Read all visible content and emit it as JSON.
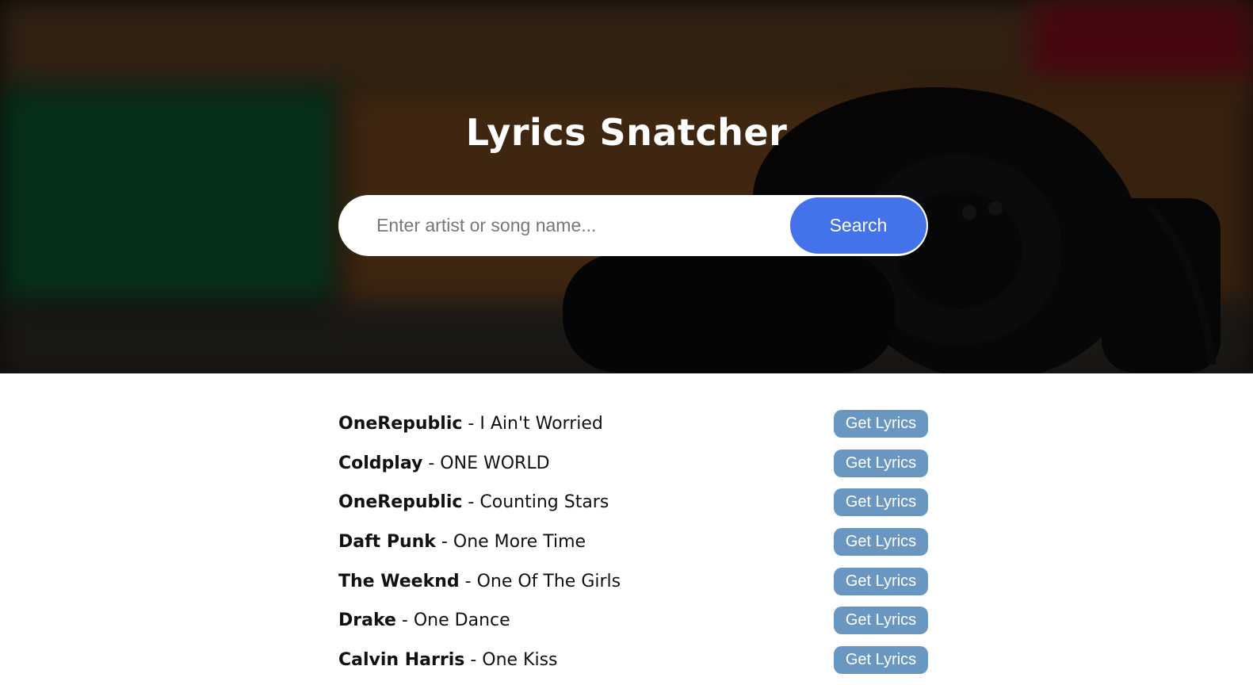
{
  "header": {
    "title": "Lyrics Snatcher"
  },
  "search": {
    "placeholder": "Enter artist or song name...",
    "value": "",
    "button_label": "Search"
  },
  "results": [
    {
      "artist": "OneRepublic",
      "separator": " - ",
      "title": "I Ain't Worried",
      "button_label": "Get Lyrics"
    },
    {
      "artist": "Coldplay",
      "separator": " - ",
      "title": "ONE WORLD",
      "button_label": "Get Lyrics"
    },
    {
      "artist": "OneRepublic",
      "separator": " - ",
      "title": "Counting Stars",
      "button_label": "Get Lyrics"
    },
    {
      "artist": "Daft Punk",
      "separator": " - ",
      "title": "One More Time",
      "button_label": "Get Lyrics"
    },
    {
      "artist": "The Weeknd",
      "separator": " - ",
      "title": "One Of The Girls",
      "button_label": "Get Lyrics"
    },
    {
      "artist": "Drake",
      "separator": " - ",
      "title": "One Dance",
      "button_label": "Get Lyrics"
    },
    {
      "artist": "Calvin Harris",
      "separator": " - ",
      "title": "One Kiss",
      "button_label": "Get Lyrics"
    }
  ],
  "colors": {
    "search_button": "#4472e8",
    "lyrics_button": "#6a97c1",
    "hero_overlay": "#000000",
    "page_background": "#ffffff"
  },
  "hero_image": {
    "icon": "headphones-photo"
  }
}
